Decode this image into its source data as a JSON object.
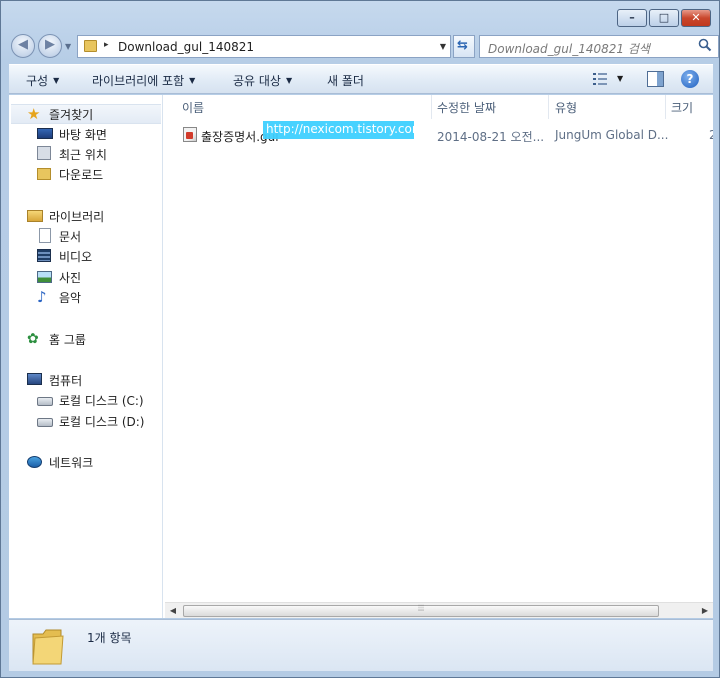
{
  "window": {
    "controls": {
      "minimize": "–",
      "maximize": "□",
      "close": "✕"
    }
  },
  "navbar": {
    "address_path": "Download_gul_140821",
    "address_separator": "▸",
    "search_placeholder": "Download_gul_140821 검색"
  },
  "toolbar": {
    "organize": "구성",
    "include_in_library": "라이브러리에 포함",
    "share_with": "공유 대상",
    "new_folder": "새 폴더",
    "help": "?"
  },
  "sidebar": {
    "favorites": {
      "label": "즐겨찾기",
      "items": [
        {
          "label": "바탕 화면",
          "icon": "desktop-icon"
        },
        {
          "label": "최근 위치",
          "icon": "recent-places-icon"
        },
        {
          "label": "다운로드",
          "icon": "downloads-icon"
        }
      ]
    },
    "libraries": {
      "label": "라이브러리",
      "items": [
        {
          "label": "문서",
          "icon": "documents-icon"
        },
        {
          "label": "비디오",
          "icon": "videos-icon"
        },
        {
          "label": "사진",
          "icon": "pictures-icon"
        },
        {
          "label": "음악",
          "icon": "music-icon"
        }
      ]
    },
    "homegroup": {
      "label": "홈 그룹"
    },
    "computer": {
      "label": "컴퓨터",
      "items": [
        {
          "label": "로컬 디스크 (C:)",
          "icon": "local-disk-c-icon"
        },
        {
          "label": "로컬 디스크 (D:)",
          "icon": "local-disk-d-icon"
        }
      ]
    },
    "network": {
      "label": "네트워크"
    }
  },
  "filelist": {
    "columns": {
      "name": "이름",
      "modified": "수정한 날짜",
      "type": "유형",
      "size": "크기"
    },
    "rows": [
      {
        "name": "출장증명서.gul",
        "modified": "2014-08-21 오전...",
        "type": "JungUm Global D...",
        "size": "2"
      }
    ],
    "watermark": "http://nexicom.tistory.com"
  },
  "statusbar": {
    "item_count": "1개 항목"
  }
}
